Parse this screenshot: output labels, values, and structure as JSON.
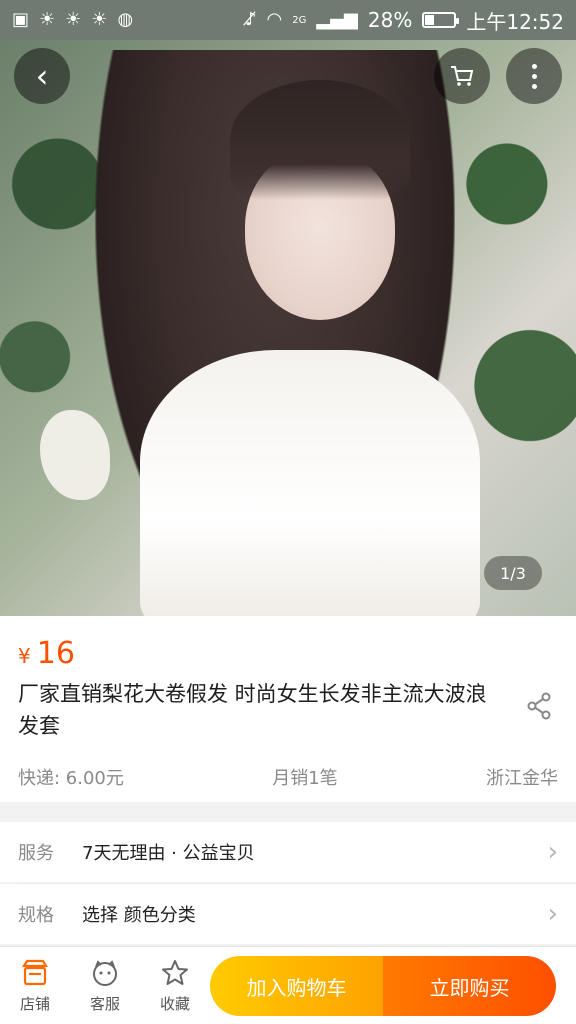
{
  "status_bar": {
    "network": "2G",
    "battery_percent": "28%",
    "battery_level": 0.28,
    "time": "上午12:52"
  },
  "gallery": {
    "counter": "1/3"
  },
  "product": {
    "currency": "¥",
    "price": "16",
    "title": "厂家直销梨花大卷假发 时尚女生长发非主流大波浪发套",
    "shipping": "快递: 6.00元",
    "monthly_sales": "月销1笔",
    "location": "浙江金华"
  },
  "service_row": {
    "label": "服务",
    "value": "7天无理由 · 公益宝贝"
  },
  "spec_row": {
    "label": "规格",
    "value": "选择 颜色分类"
  },
  "bottom_bar": {
    "shop_label": "店铺",
    "service_label": "客服",
    "favorite_label": "收藏",
    "add_to_cart_label": "加入购物车",
    "buy_now_label": "立即购买"
  },
  "colors": {
    "accent": "#ff5000",
    "cart_button": "#ffa200",
    "buy_button": "#ff5000"
  }
}
